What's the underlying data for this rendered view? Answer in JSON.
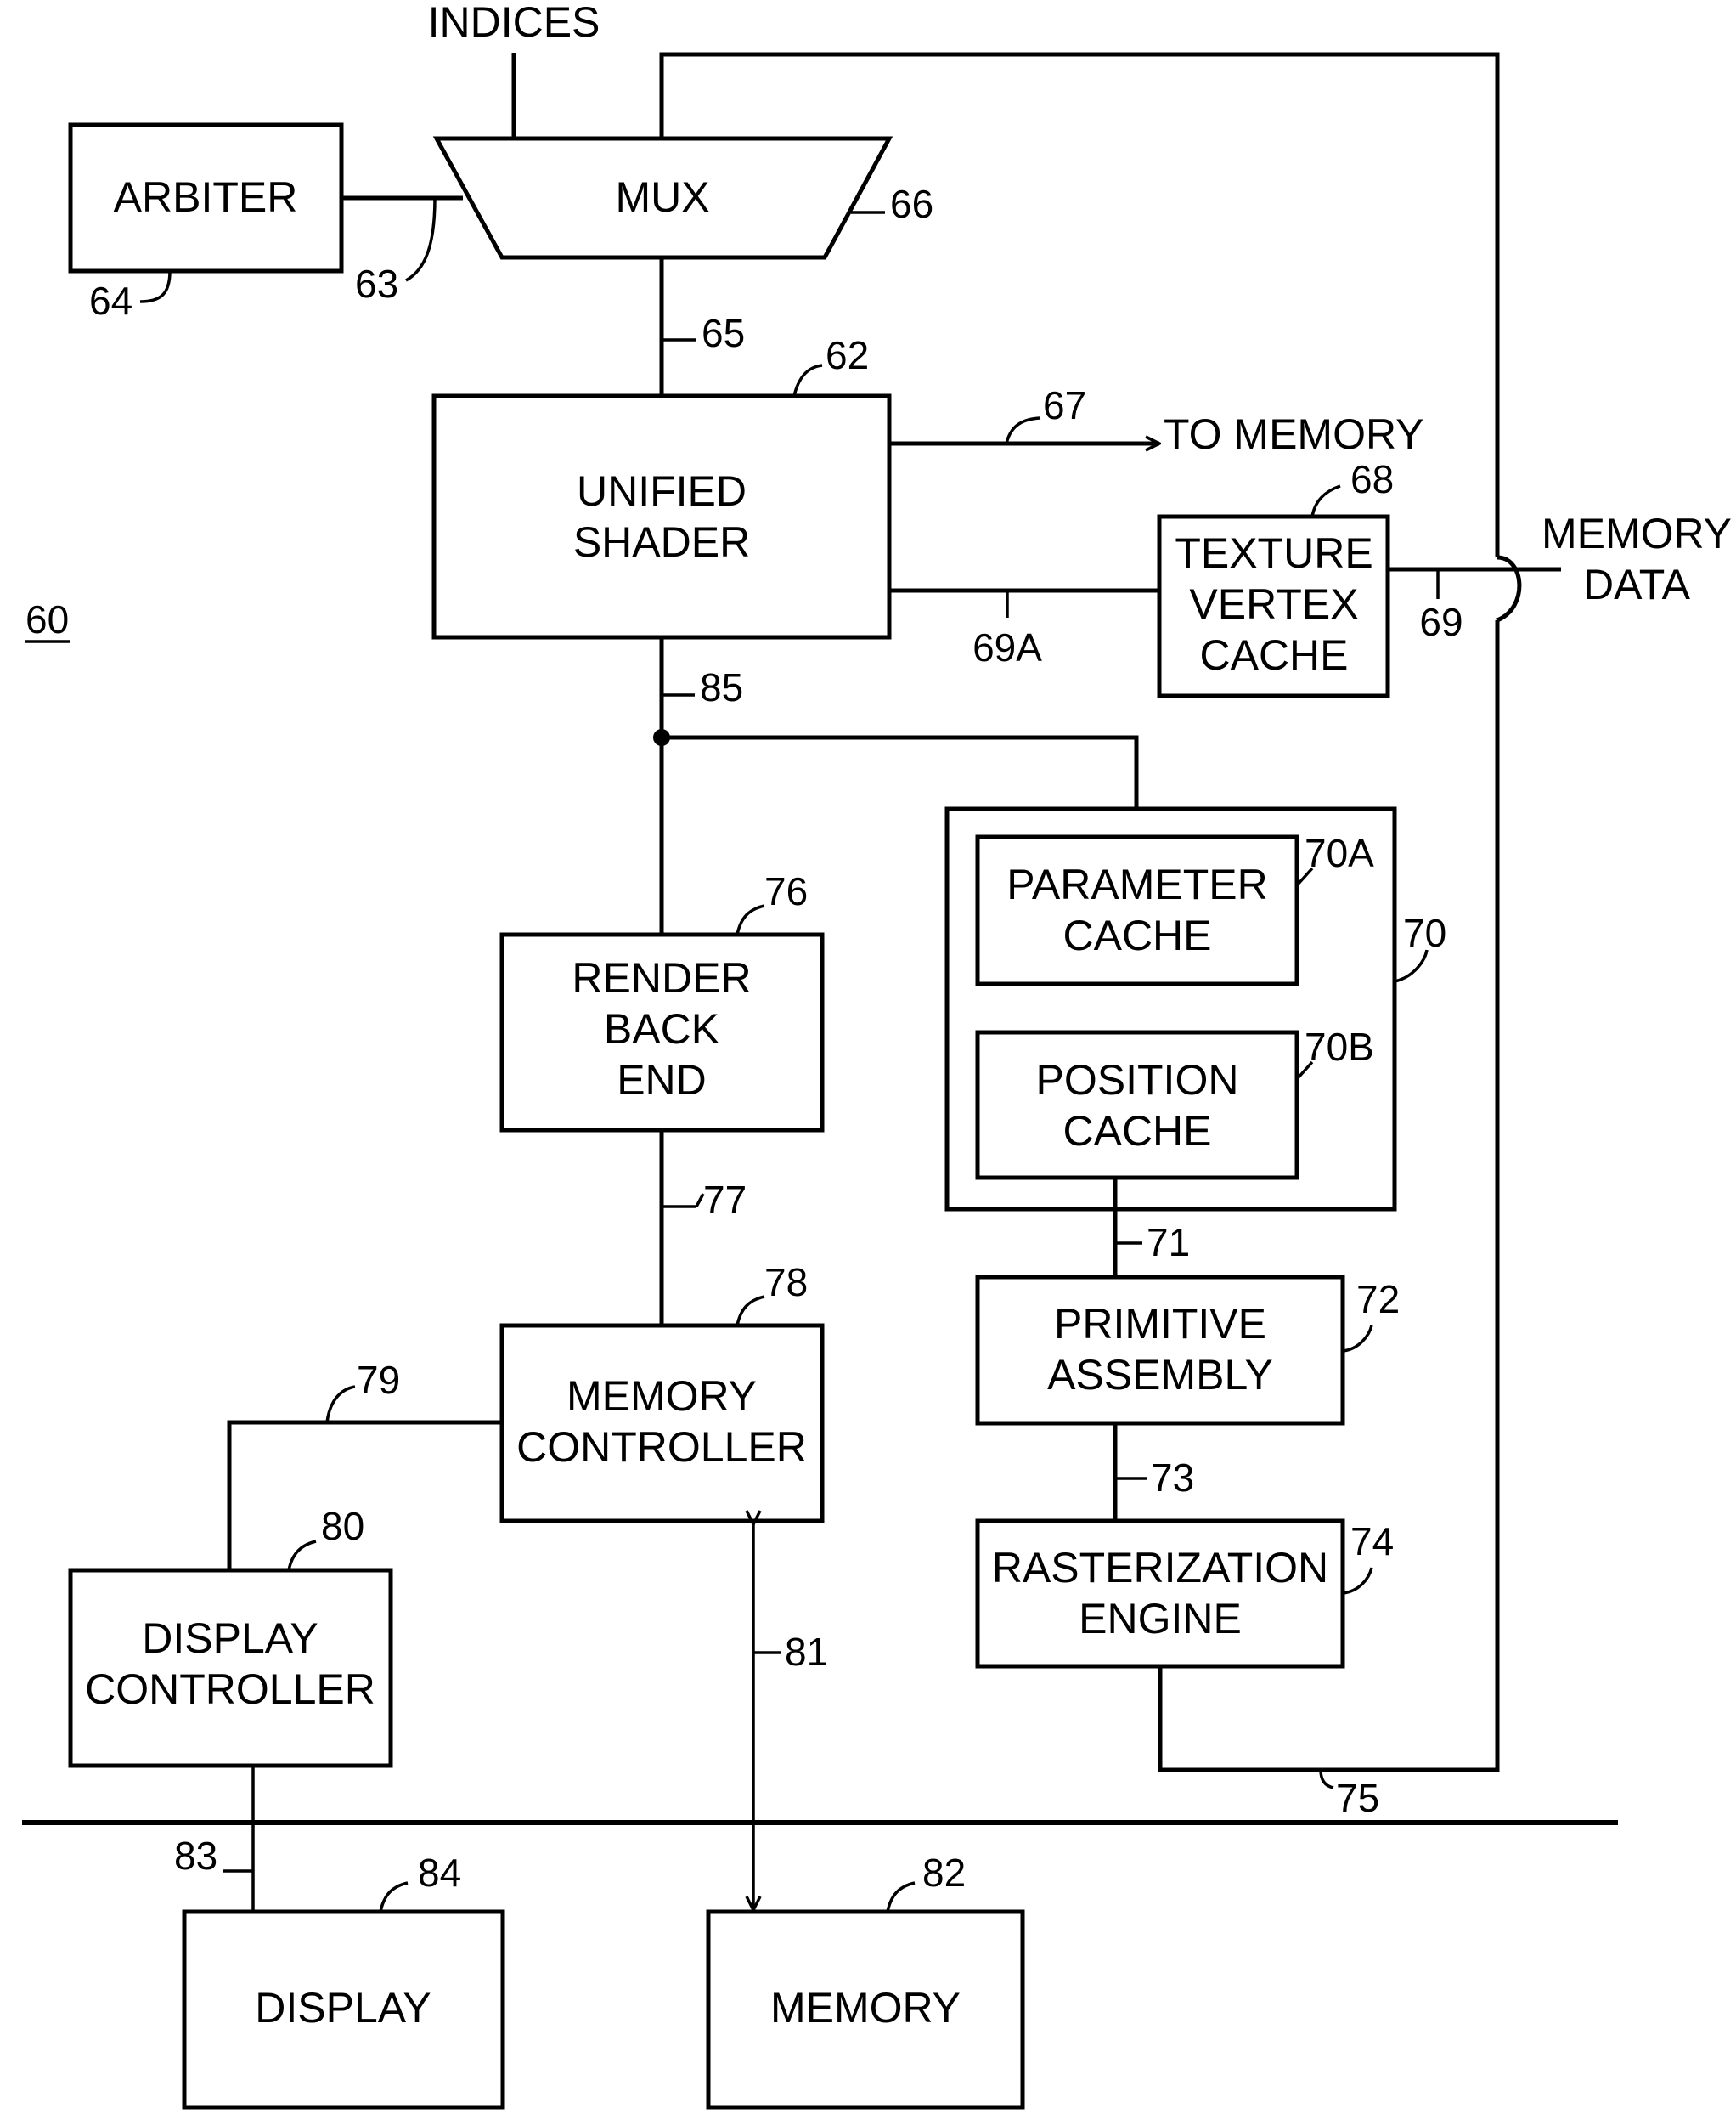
{
  "figure": {
    "figure_label": "60",
    "blocks": {
      "arbiter": {
        "lines": [
          "ARBITER"
        ],
        "ref": "64"
      },
      "mux": {
        "lines": [
          "MUX"
        ],
        "ref": "66"
      },
      "unified_shader": {
        "lines": [
          "UNIFIED",
          "SHADER"
        ],
        "ref": "62"
      },
      "texture_vertex_cache": {
        "lines": [
          "TEXTURE",
          "VERTEX",
          "CACHE"
        ],
        "ref": "68"
      },
      "cache_group": {
        "ref": "70"
      },
      "parameter_cache": {
        "lines": [
          "PARAMETER",
          "CACHE"
        ],
        "ref": "70A"
      },
      "position_cache": {
        "lines": [
          "POSITION",
          "CACHE"
        ],
        "ref": "70B"
      },
      "primitive_assembly": {
        "lines": [
          "PRIMITIVE",
          "ASSEMBLY"
        ],
        "ref": "72"
      },
      "rasterization_engine": {
        "lines": [
          "RASTERIZATION",
          "ENGINE"
        ],
        "ref": "74"
      },
      "render_back_end": {
        "lines": [
          "RENDER",
          "BACK",
          "END"
        ],
        "ref": "76"
      },
      "memory_controller": {
        "lines": [
          "MEMORY",
          "CONTROLLER"
        ],
        "ref": "78"
      },
      "display_controller": {
        "lines": [
          "DISPLAY",
          "CONTROLLER"
        ],
        "ref": "80"
      },
      "display": {
        "lines": [
          "DISPLAY"
        ],
        "ref": "84"
      },
      "memory": {
        "lines": [
          "MEMORY"
        ],
        "ref": "82"
      }
    },
    "signals": {
      "indices": "INDICES",
      "to_memory": "TO MEMORY",
      "memory_data": [
        "MEMORY",
        "DATA"
      ]
    },
    "connection_refs": {
      "arbiter_mux": "63",
      "mux_shader": "65",
      "shader_to_memory": "67",
      "shader_texture": "69A",
      "texture_memory_data": "69",
      "shader_out": "85",
      "position_primitive": "71",
      "primitive_raster": "73",
      "raster_feedback": "75",
      "render_memctrl": "77",
      "memctrl_display": "79",
      "memctrl_memory": "81",
      "displayctrl_display": "83"
    }
  }
}
